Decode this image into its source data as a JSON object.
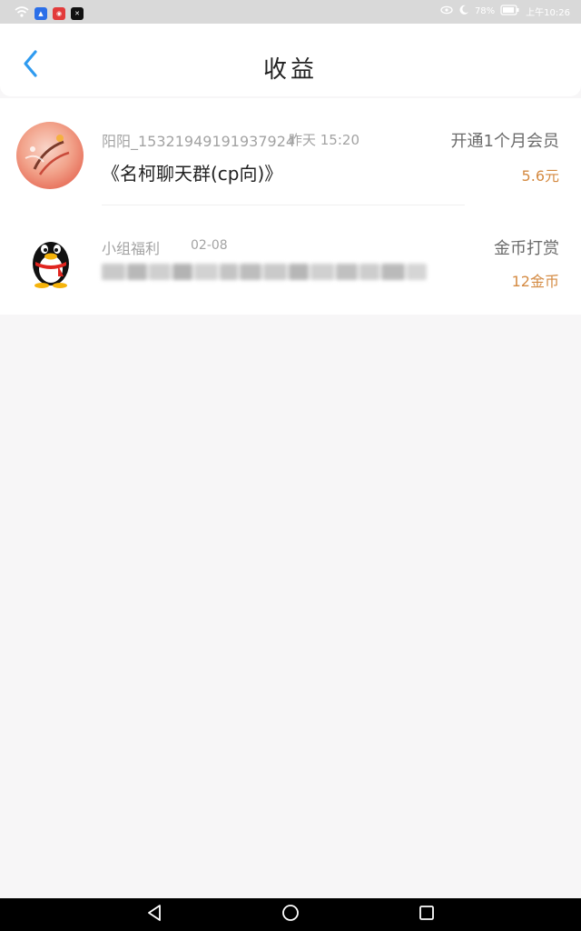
{
  "status_bar": {
    "battery": "78%",
    "time": "上午10:26",
    "icons": [
      "wifi-icon",
      "app-icon",
      "app-icon",
      "app-icon",
      "eye-icon",
      "moon-icon",
      "battery-icon"
    ]
  },
  "header": {
    "title": "收益",
    "back_icon": "chevron-left-icon"
  },
  "items": [
    {
      "name": "阳阳_15321949191937924",
      "time": "昨天 15:20",
      "message": "《名柯聊天群(cp向)》",
      "action": "开通1个月会员",
      "amount": "5.6元"
    },
    {
      "name": "小组福利",
      "time": "02-08",
      "message": "",
      "action": "金币打赏",
      "amount": "12金币"
    }
  ],
  "colors": {
    "accent": "#2f9bf0",
    "amount": "#d48a42",
    "secondary_text": "#a3a3a3",
    "background": "#f7f6f7"
  },
  "nav_bar": {
    "icons": [
      "back-triangle-icon",
      "home-circle-icon",
      "recents-square-icon"
    ]
  }
}
